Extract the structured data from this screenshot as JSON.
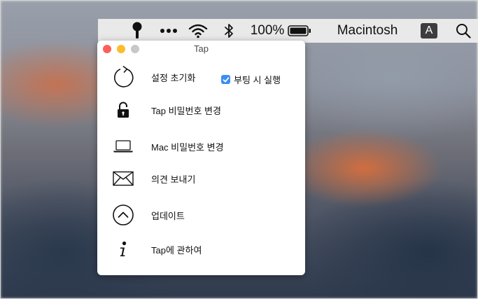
{
  "menubar": {
    "battery_percent": "100%",
    "user_name": "Macintosh",
    "input_source": "A",
    "icons": [
      "tap-key-icon",
      "more-icon",
      "wifi-icon",
      "bluetooth-icon",
      "battery-icon",
      "input-source-icon",
      "spotlight-search-icon"
    ]
  },
  "window": {
    "title": "Tap",
    "traffic_light_colors": {
      "close": "#fe5f57",
      "minimize": "#febc2e",
      "zoom": "#c8c8c8"
    }
  },
  "menu": {
    "items": [
      {
        "label": "설정 초기화",
        "icon": "reset-icon"
      },
      {
        "label": "Tap 비밀번호 변경",
        "icon": "lock-icon"
      },
      {
        "label": "Mac 비밀번호 변경",
        "icon": "laptop-icon"
      },
      {
        "label": "의견 보내기",
        "icon": "envelope-icon"
      },
      {
        "label": "업데이트",
        "icon": "update-icon"
      },
      {
        "label": "Tap에 관하여",
        "icon": "info-icon"
      }
    ],
    "launch_at_login": {
      "label": "부팅 시 실행",
      "checked": true
    }
  }
}
